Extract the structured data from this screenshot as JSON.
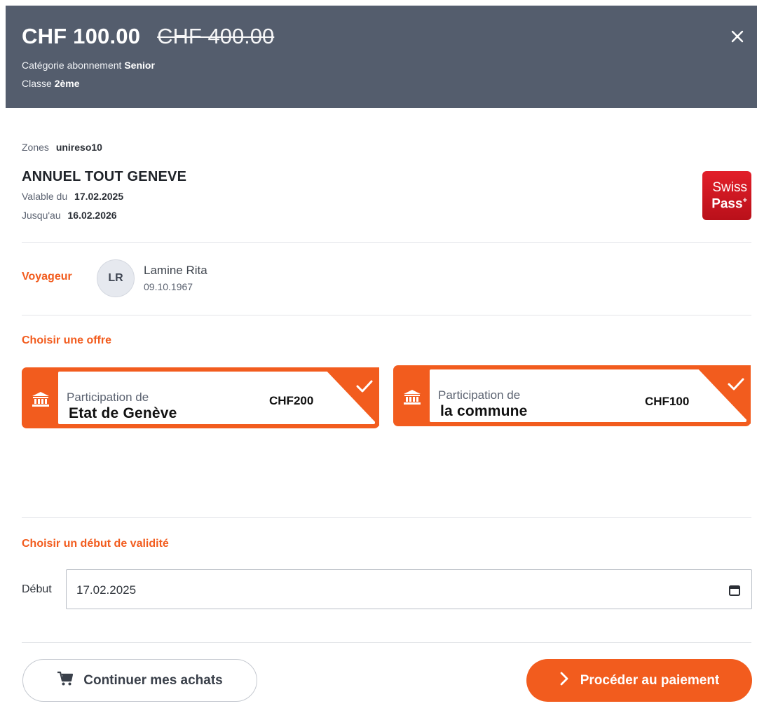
{
  "header": {
    "price_current": "CHF 100.00",
    "price_original": "CHF 400.00",
    "category_label": "Catégorie abonnement",
    "category_value": "Senior",
    "class_label": "Classe",
    "class_value": "2ème",
    "close_icon": "close-icon"
  },
  "ticket": {
    "zones_label": "Zones",
    "zones_value": "unireso10",
    "name": "ANNUEL TOUT GENEVE",
    "valid_from_label": "Valable du",
    "valid_from_value": "17.02.2025",
    "valid_to_label": "Jusqu'au",
    "valid_to_value": "16.02.2026",
    "swisspass_line1": "Swiss",
    "swisspass_line2": "Pass"
  },
  "traveler": {
    "section_label": "Voyageur",
    "initials": "LR",
    "name": "Lamine Rita",
    "birthdate": "09.10.1967"
  },
  "offers": {
    "section_label": "Choisir une offre",
    "items": [
      {
        "label": "Participation de",
        "organization": "Etat de Genève",
        "amount": "CHF200",
        "selected": true,
        "icon": "bank-icon"
      },
      {
        "label": "Participation de",
        "organization": "la commune",
        "amount": "CHF100",
        "selected": true,
        "icon": "bank-icon"
      }
    ]
  },
  "validity": {
    "section_label": "Choisir un début de validité",
    "start_label": "Début",
    "start_value": "17.02.2025",
    "calendar_icon": "calendar-icon"
  },
  "actions": {
    "continue_label": "Continuer mes achats",
    "continue_icon": "cart-icon",
    "pay_label": "Procéder au paiement",
    "pay_icon": "chevron-right-icon"
  },
  "colors": {
    "accent": "#f25c1e",
    "header_bg": "#545d6d"
  }
}
